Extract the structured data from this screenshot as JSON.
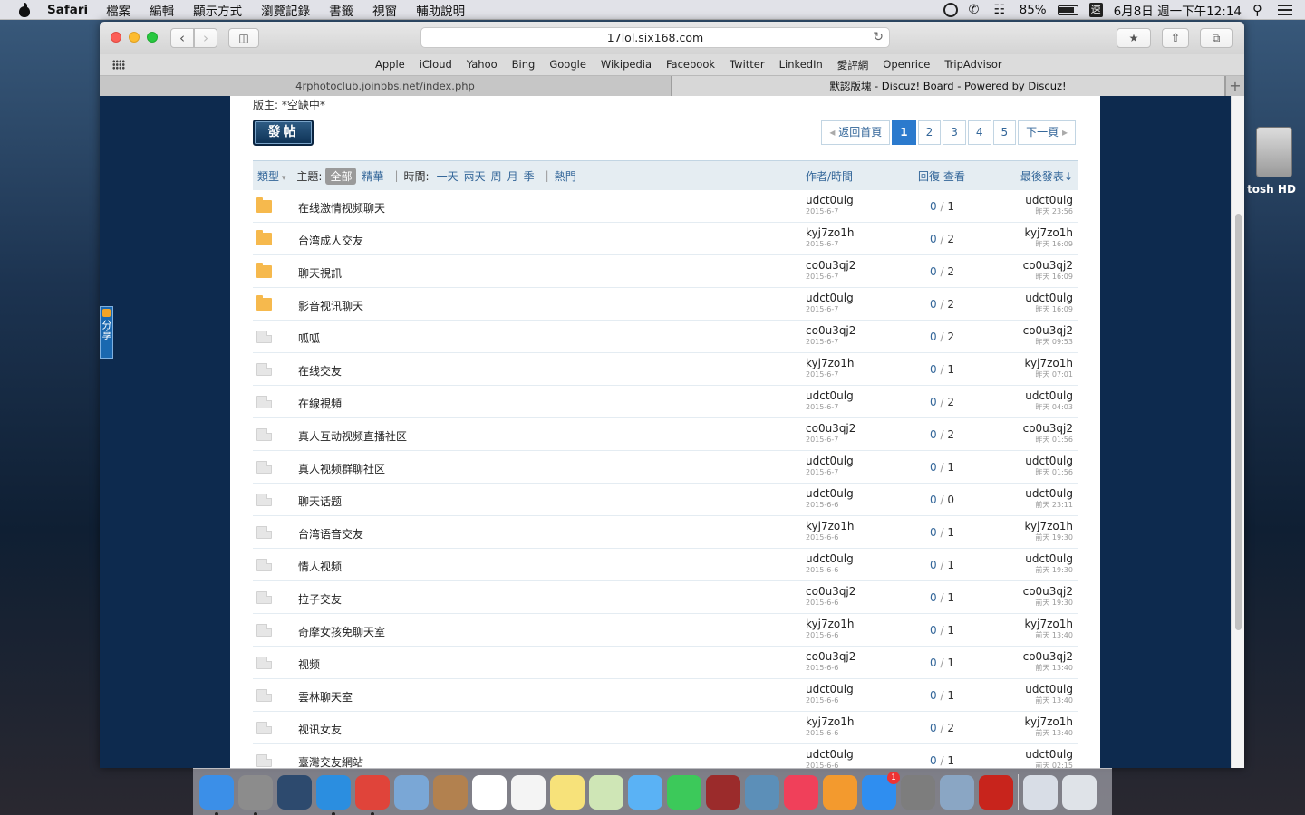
{
  "menubar": {
    "app_name": "Safari",
    "items": [
      "檔案",
      "編輯",
      "顯示方式",
      "瀏覽記錄",
      "書籤",
      "視窗",
      "輔助說明"
    ],
    "battery": "85%",
    "ime": "速",
    "clock": "6月8日 週一下午12:14"
  },
  "desktop": {
    "hd_label": "tosh HD"
  },
  "browser": {
    "url": "17lol.six168.com",
    "favorites": [
      "Apple",
      "iCloud",
      "Yahoo",
      "Bing",
      "Google",
      "Wikipedia",
      "Facebook",
      "Twitter",
      "LinkedIn",
      "愛評網",
      "Openrice",
      "TripAdvisor"
    ],
    "tabs": [
      {
        "title": "4rphotoclub.joinbbs.net/index.php",
        "active": false
      },
      {
        "title": "默認版塊 - Discuz! Board - Powered by Discuz!",
        "active": true
      }
    ]
  },
  "forum": {
    "moderator": "版主: *空缺中*",
    "post_button": "發帖",
    "pager": {
      "back": "返回首頁",
      "pages": [
        "1",
        "2",
        "3",
        "4",
        "5"
      ],
      "current": "1",
      "next": "下一頁"
    },
    "filter": {
      "type": "類型",
      "theme_label": "主題:",
      "all": "全部",
      "digest": "精華",
      "time_label": "時間:",
      "times": [
        "一天",
        "兩天",
        "周",
        "月",
        "季"
      ],
      "hot": "熱門",
      "author_col": "作者/時間",
      "reply_col": "回復",
      "view_col": "查看",
      "last_col": "最後發表"
    },
    "threads": [
      {
        "icon": "folder",
        "title": "在线激情视频聊天",
        "author": "udct0ulg",
        "date": "2015-6-7",
        "replies": "0",
        "views": "1",
        "last_user": "udct0ulg",
        "last_time": "昨天 23:56"
      },
      {
        "icon": "folder",
        "title": "台湾成人交友",
        "author": "kyj7zo1h",
        "date": "2015-6-7",
        "replies": "0",
        "views": "2",
        "last_user": "kyj7zo1h",
        "last_time": "昨天 16:09"
      },
      {
        "icon": "folder",
        "title": "聊天視訊",
        "author": "co0u3qj2",
        "date": "2015-6-7",
        "replies": "0",
        "views": "2",
        "last_user": "co0u3qj2",
        "last_time": "昨天 16:09"
      },
      {
        "icon": "folder",
        "title": "影音视讯聊天",
        "author": "udct0ulg",
        "date": "2015-6-7",
        "replies": "0",
        "views": "2",
        "last_user": "udct0ulg",
        "last_time": "昨天 16:09"
      },
      {
        "icon": "doc",
        "title": "呱呱",
        "author": "co0u3qj2",
        "date": "2015-6-7",
        "replies": "0",
        "views": "2",
        "last_user": "co0u3qj2",
        "last_time": "昨天 09:53"
      },
      {
        "icon": "doc",
        "title": "在线交友",
        "author": "kyj7zo1h",
        "date": "2015-6-7",
        "replies": "0",
        "views": "1",
        "last_user": "kyj7zo1h",
        "last_time": "昨天 07:01"
      },
      {
        "icon": "doc",
        "title": "在線視頻",
        "author": "udct0ulg",
        "date": "2015-6-7",
        "replies": "0",
        "views": "2",
        "last_user": "udct0ulg",
        "last_time": "昨天 04:03"
      },
      {
        "icon": "doc",
        "title": "真人互动视频直播社区",
        "author": "co0u3qj2",
        "date": "2015-6-7",
        "replies": "0",
        "views": "2",
        "last_user": "co0u3qj2",
        "last_time": "昨天 01:56"
      },
      {
        "icon": "doc",
        "title": "真人视频群聊社区",
        "author": "udct0ulg",
        "date": "2015-6-7",
        "replies": "0",
        "views": "1",
        "last_user": "udct0ulg",
        "last_time": "昨天 01:56"
      },
      {
        "icon": "doc",
        "title": "聊天话题",
        "author": "udct0ulg",
        "date": "2015-6-6",
        "replies": "0",
        "views": "0",
        "last_user": "udct0ulg",
        "last_time": "前天 23:11"
      },
      {
        "icon": "doc",
        "title": "台湾语音交友",
        "author": "kyj7zo1h",
        "date": "2015-6-6",
        "replies": "0",
        "views": "1",
        "last_user": "kyj7zo1h",
        "last_time": "前天 19:30"
      },
      {
        "icon": "doc",
        "title": "情人视频",
        "author": "udct0ulg",
        "date": "2015-6-6",
        "replies": "0",
        "views": "1",
        "last_user": "udct0ulg",
        "last_time": "前天 19:30"
      },
      {
        "icon": "doc",
        "title": "拉子交友",
        "author": "co0u3qj2",
        "date": "2015-6-6",
        "replies": "0",
        "views": "1",
        "last_user": "co0u3qj2",
        "last_time": "前天 19:30"
      },
      {
        "icon": "doc",
        "title": "奇摩女孩免聊天室",
        "author": "kyj7zo1h",
        "date": "2015-6-6",
        "replies": "0",
        "views": "1",
        "last_user": "kyj7zo1h",
        "last_time": "前天 13:40"
      },
      {
        "icon": "doc",
        "title": "视频",
        "author": "co0u3qj2",
        "date": "2015-6-6",
        "replies": "0",
        "views": "1",
        "last_user": "co0u3qj2",
        "last_time": "前天 13:40"
      },
      {
        "icon": "doc",
        "title": "雲林聊天室",
        "author": "udct0ulg",
        "date": "2015-6-6",
        "replies": "0",
        "views": "1",
        "last_user": "udct0ulg",
        "last_time": "前天 13:40"
      },
      {
        "icon": "doc",
        "title": "视讯女友",
        "author": "kyj7zo1h",
        "date": "2015-6-6",
        "replies": "0",
        "views": "2",
        "last_user": "kyj7zo1h",
        "last_time": "前天 13:40"
      },
      {
        "icon": "doc",
        "title": "臺灣交友網站",
        "author": "udct0ulg",
        "date": "2015-6-6",
        "replies": "0",
        "views": "1",
        "last_user": "udct0ulg",
        "last_time": "前天 02:15"
      }
    ]
  },
  "share": {
    "label": "分享"
  },
  "dock": {
    "apps": [
      {
        "name": "finder-icon",
        "color": "#3b8fe8",
        "running": true
      },
      {
        "name": "launchpad-icon",
        "color": "#8c8c8c",
        "running": true
      },
      {
        "name": "dashboard-icon",
        "color": "#2d4a6e",
        "running": false
      },
      {
        "name": "safari-icon",
        "color": "#2b8ee0",
        "running": true
      },
      {
        "name": "chrome-icon",
        "color": "#e0443a",
        "running": true
      },
      {
        "name": "preview-icon",
        "color": "#7aa7d6",
        "running": false
      },
      {
        "name": "contacts-icon",
        "color": "#b2814f",
        "running": false
      },
      {
        "name": "calendar-icon",
        "color": "#ffffff",
        "running": false
      },
      {
        "name": "reminders-icon",
        "color": "#f4f4f4",
        "running": false
      },
      {
        "name": "notes-icon",
        "color": "#f7e27a",
        "running": false
      },
      {
        "name": "maps-icon",
        "color": "#cfe6b6",
        "running": false
      },
      {
        "name": "messages-icon",
        "color": "#5ab2f5",
        "running": false
      },
      {
        "name": "facetime-icon",
        "color": "#3cc95a",
        "running": false
      },
      {
        "name": "photo-booth-icon",
        "color": "#9b2b2b",
        "running": false
      },
      {
        "name": "iphoto-icon",
        "color": "#5c8fb8",
        "running": false
      },
      {
        "name": "itunes-icon",
        "color": "#f0405a",
        "running": false
      },
      {
        "name": "ibooks-icon",
        "color": "#f39a2e",
        "running": false
      },
      {
        "name": "app-store-icon",
        "color": "#2f8ef0",
        "running": false,
        "badge": "1"
      },
      {
        "name": "system-preferences-icon",
        "color": "#7d7d7d",
        "running": false
      },
      {
        "name": "migration-icon",
        "color": "#8aa6c4",
        "running": false
      },
      {
        "name": "filezilla-icon",
        "color": "#c8241c",
        "running": false
      }
    ],
    "extras": [
      {
        "name": "downloads-icon",
        "color": "#d8dde6"
      },
      {
        "name": "trash-icon",
        "color": "#dfe3e8"
      }
    ]
  }
}
